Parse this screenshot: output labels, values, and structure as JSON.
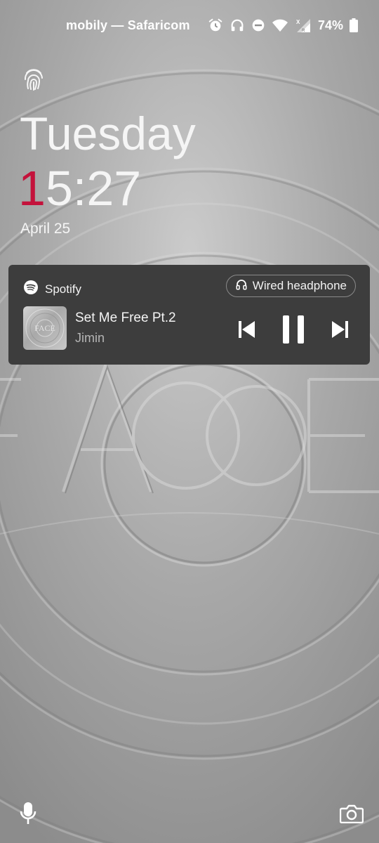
{
  "status_bar": {
    "carrier": "mobily — Safaricom",
    "battery_percent": "74%",
    "icons": [
      "alarm-icon",
      "headphones-icon",
      "do-not-disturb-icon",
      "wifi-icon",
      "cellular-signal-icon",
      "battery-icon"
    ],
    "network_label": "X R"
  },
  "lockscreen": {
    "day": "Tuesday",
    "clock_hour_first_digit": "1",
    "clock_rest": "5:27",
    "date": "April 25",
    "accent_color": "#c4123b"
  },
  "media": {
    "app_name": "Spotify",
    "output_device": "Wired headphone",
    "track_title": "Set Me Free Pt.2",
    "artist": "Jimin",
    "album_art_text": "FACE",
    "state": "playing",
    "card_color": "#3d3d3d"
  },
  "shortcuts": {
    "left": "microphone-icon",
    "right": "camera-icon"
  }
}
